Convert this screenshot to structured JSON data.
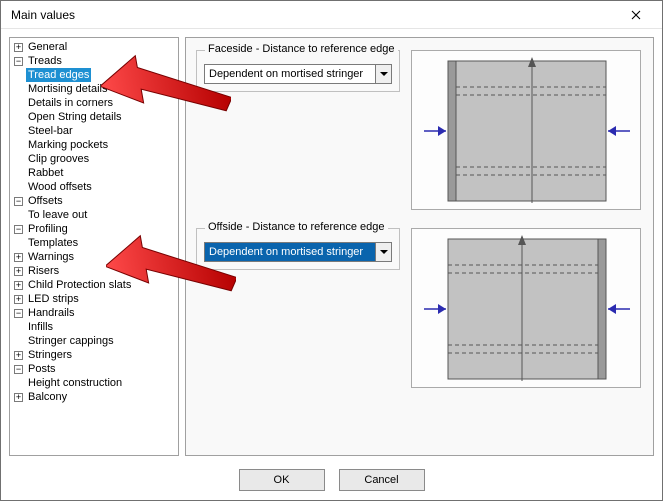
{
  "window": {
    "title": "Main values"
  },
  "tree": {
    "general": "General",
    "treads": "Treads",
    "tread_children": {
      "tread_edges": "Tread edges",
      "mortising_details": "Mortising details",
      "details_in_corners": "Details in corners",
      "open_string_details": "Open String details",
      "steel_bar": "Steel-bar",
      "marking_pockets": "Marking pockets",
      "clip_grooves": "Clip grooves",
      "rabbet": "Rabbet",
      "wood_offsets": "Wood offsets"
    },
    "offsets": "Offsets",
    "offsets_children": {
      "to_leave_out": "To leave out"
    },
    "profiling": "Profiling",
    "profiling_children": {
      "templates": "Templates"
    },
    "warnings": "Warnings",
    "risers": "Risers",
    "child_protection": "Child Protection slats",
    "led_strips": "LED strips",
    "handrails": "Handrails",
    "handrails_children": {
      "infills": "Infills",
      "stringer_cappings": "Stringer cappings"
    },
    "stringers": "Stringers",
    "posts": "Posts",
    "posts_children": {
      "height_construction": "Height construction"
    },
    "balcony": "Balcony"
  },
  "content": {
    "group1_legend": "Faceside - Distance to reference edge",
    "combo1_value": "Dependent on mortised stringer",
    "group2_legend": "Offside - Distance to reference edge",
    "combo2_value": "Dependent on mortised stringer"
  },
  "footer": {
    "ok": "OK",
    "cancel": "Cancel"
  }
}
